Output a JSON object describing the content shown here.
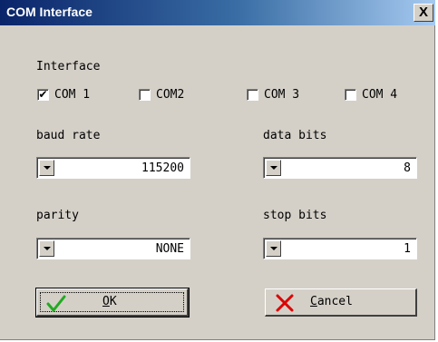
{
  "window": {
    "title": "COM Interface",
    "close_label": "X"
  },
  "interface": {
    "heading": "Interface",
    "ports": [
      {
        "label": "COM 1",
        "checked": true
      },
      {
        "label": "COM2",
        "checked": false
      },
      {
        "label": "COM 3",
        "checked": false
      },
      {
        "label": "COM 4",
        "checked": false
      }
    ]
  },
  "fields": {
    "baud_rate": {
      "label": "baud rate",
      "value": "115200"
    },
    "data_bits": {
      "label": "data bits",
      "value": "8"
    },
    "parity": {
      "label": "parity",
      "value": "NONE"
    },
    "stop_bits": {
      "label": "stop bits",
      "value": "1"
    }
  },
  "buttons": {
    "ok": {
      "accel": "O",
      "rest": "K",
      "icon": "checkmark-icon"
    },
    "cancel": {
      "accel": "C",
      "rest": "ancel",
      "icon": "x-mark-icon"
    }
  },
  "colors": {
    "titlebar_start": "#0a246a",
    "titlebar_end": "#a6caf0",
    "face": "#d4d0c8",
    "ok_check": "#22aa22",
    "cancel_x": "#dd0000"
  }
}
